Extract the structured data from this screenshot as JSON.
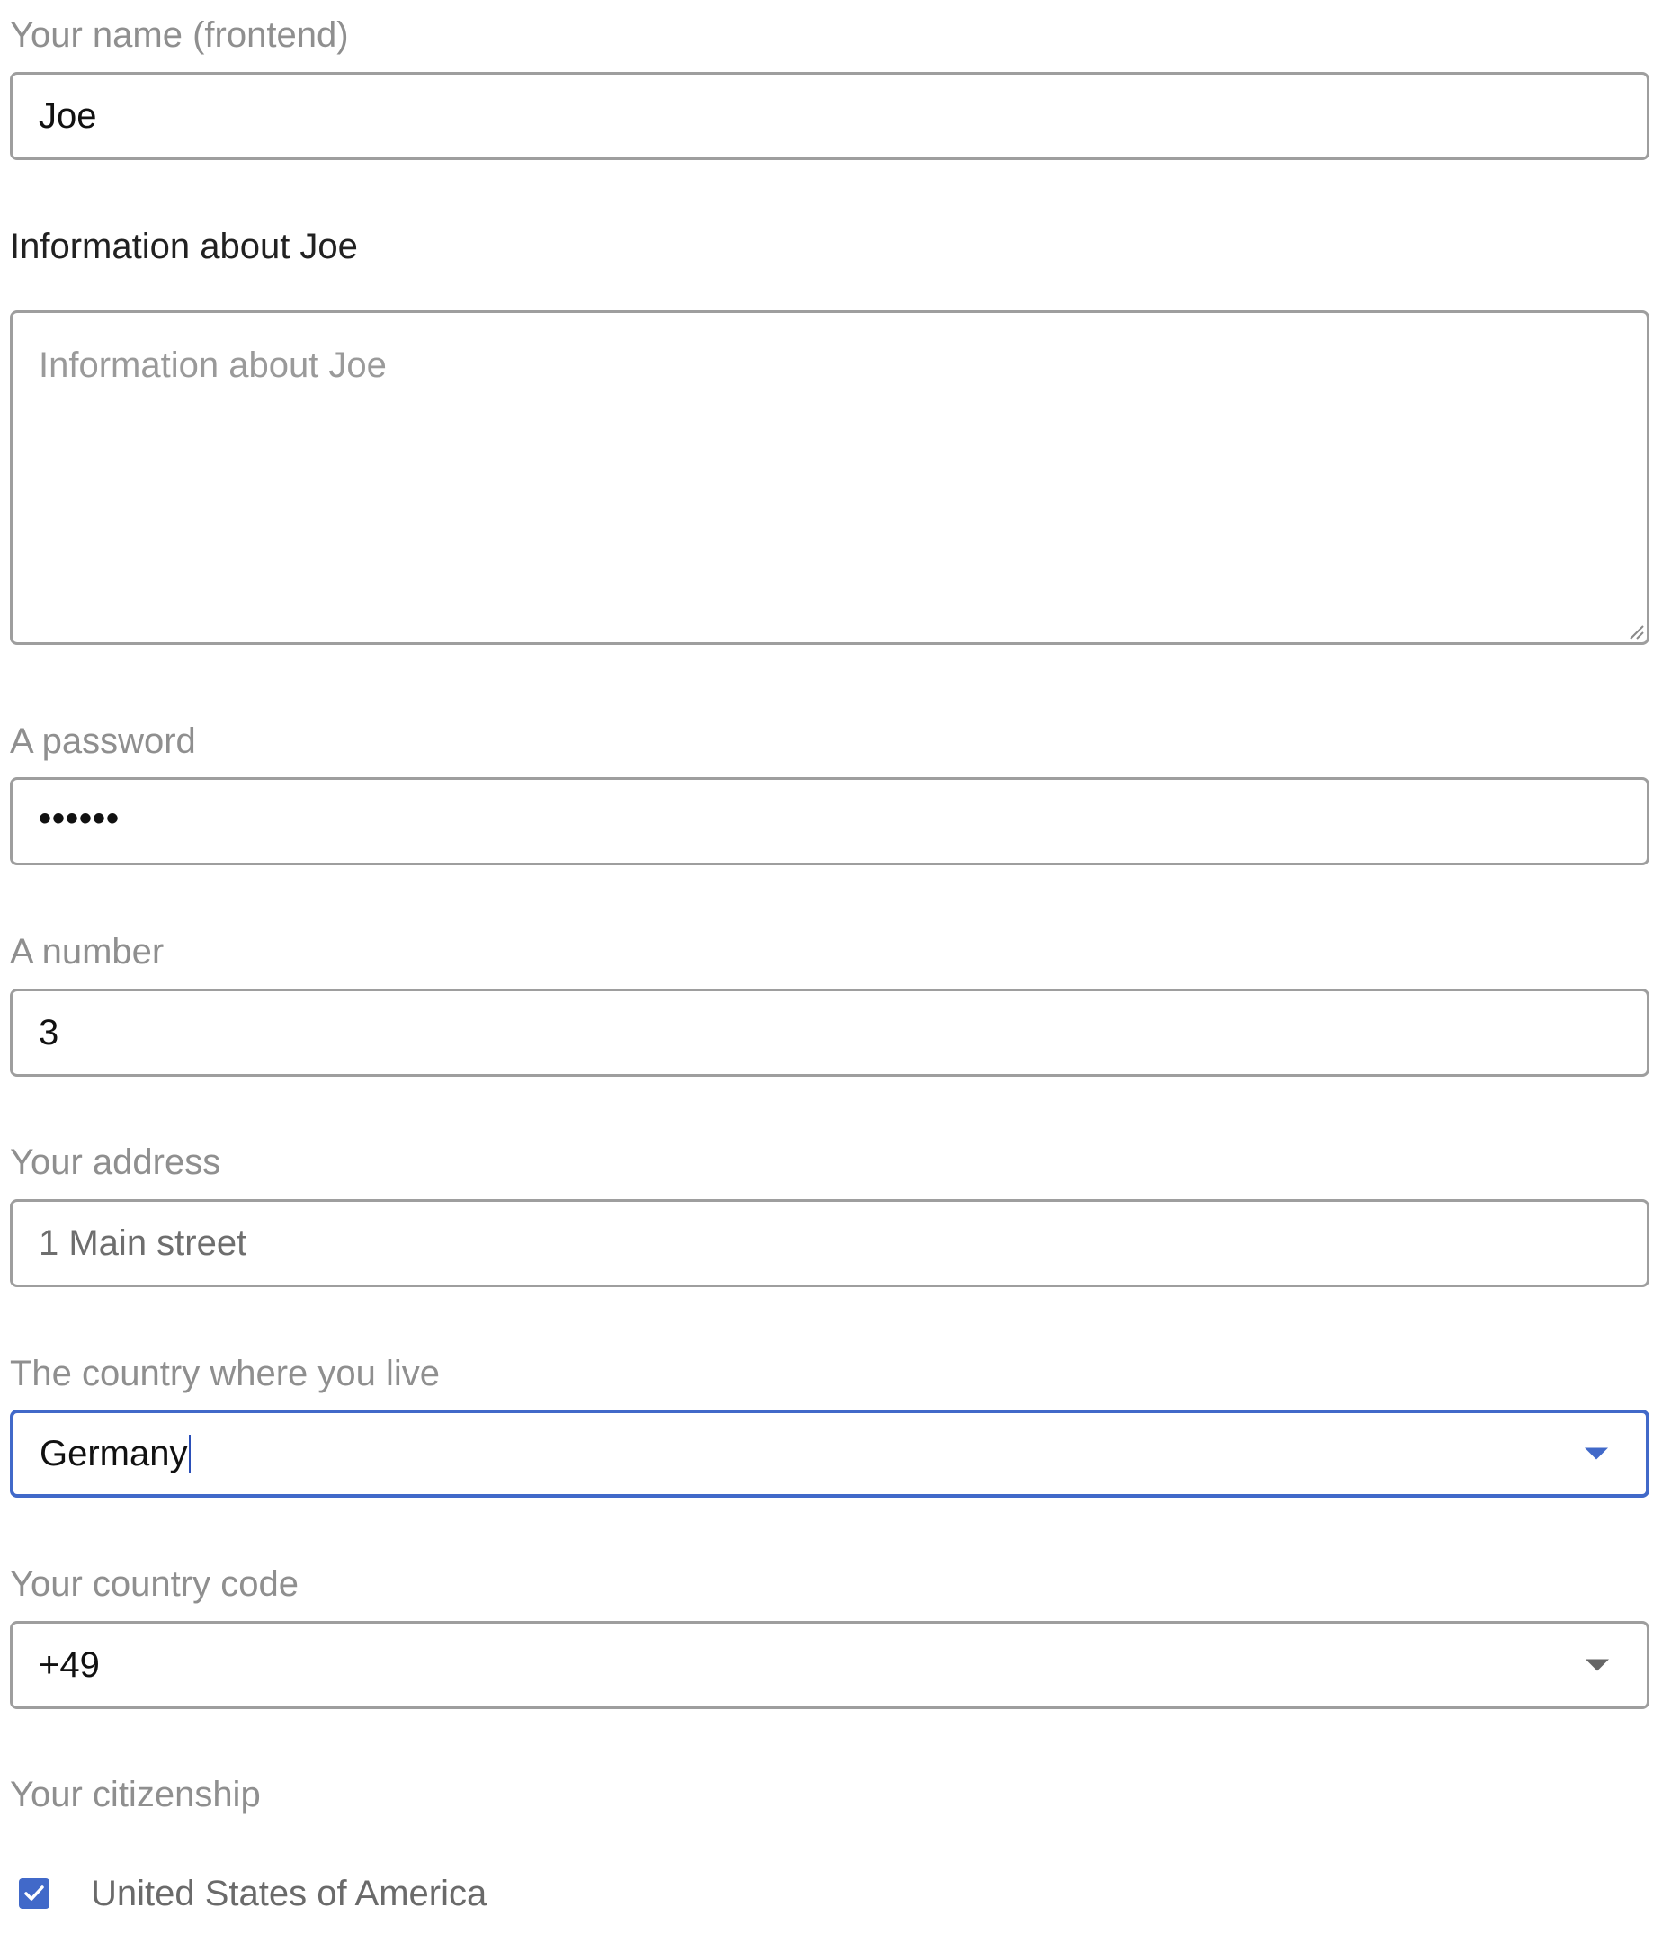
{
  "form": {
    "name": {
      "label": "Your name (frontend)",
      "value": "Joe"
    },
    "info": {
      "label": "Information about Joe",
      "placeholder": "Information about Joe"
    },
    "password": {
      "label": "A password",
      "value": "••••••"
    },
    "number": {
      "label": "A number",
      "value": "3"
    },
    "address": {
      "label": "Your address",
      "value": "1 Main street"
    },
    "country": {
      "label": "The country where you live",
      "value": "Germany",
      "focused": true,
      "icon": "chevron-down-icon"
    },
    "country_code": {
      "label": "Your country code",
      "value": "+49",
      "icon": "chevron-down-icon"
    },
    "citizenship": {
      "label": "Your citizenship",
      "options": [
        {
          "label": "United States of America",
          "checked": true
        }
      ]
    }
  },
  "colors": {
    "accent": "#4169c9",
    "border": "#9e9e9e",
    "label": "#8f8f8f"
  }
}
